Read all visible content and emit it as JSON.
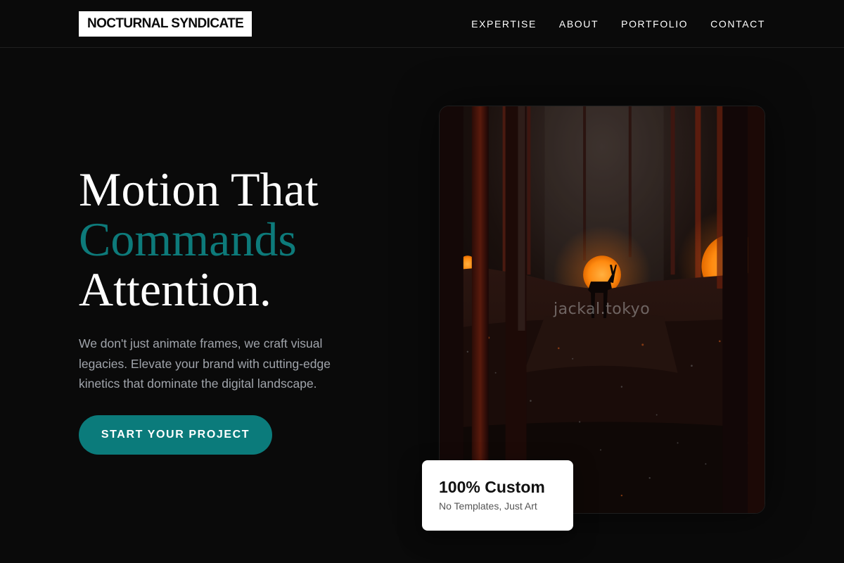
{
  "brand": {
    "name": "NOCTURNAL SYNDICATE"
  },
  "nav": {
    "items": [
      {
        "label": "EXPERTISE"
      },
      {
        "label": "ABOUT"
      },
      {
        "label": "PORTFOLIO"
      },
      {
        "label": "CONTACT"
      }
    ]
  },
  "hero": {
    "title_line1": "Motion That",
    "title_line2": "Commands",
    "title_line3": "Attention.",
    "description": "We don't just animate frames, we craft visual legacies. Elevate your brand with cutting-edge kinetics that dominate the digital landscape.",
    "cta_label": "START YOUR PROJECT"
  },
  "media": {
    "watermark": "jackal.tokyo"
  },
  "badge": {
    "title": "100% Custom",
    "subtitle": "No Templates, Just Art"
  },
  "colors": {
    "accent": "#0d7a7a",
    "background": "#0a0a0a",
    "glow": "#ff8a10"
  }
}
